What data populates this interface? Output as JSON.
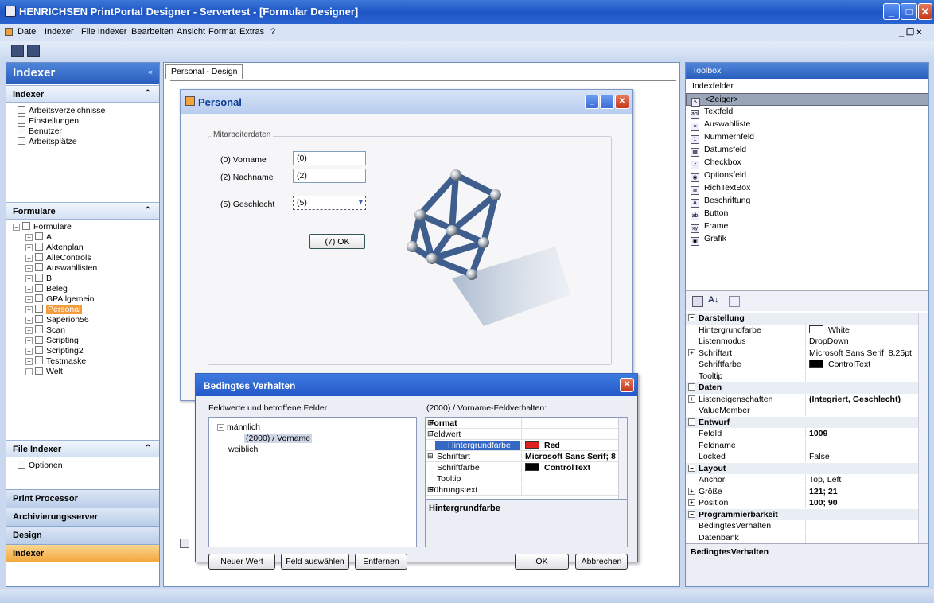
{
  "window": {
    "title": "HENRICHSEN PrintPortal Designer - Servertest - [Formular Designer]"
  },
  "menu": [
    "Datei",
    "Indexer",
    "File Indexer",
    "Bearbeiten",
    "Ansicht",
    "Format",
    "Extras",
    "?"
  ],
  "left": {
    "header": "Indexer",
    "indexer_section": "Indexer",
    "indexer_items": [
      "Arbeitsverzeichnisse",
      "Einstellungen",
      "Benutzer",
      "Arbeitsplätze"
    ],
    "formulare_section": "Formulare",
    "formulare_root": "Formulare",
    "formulare_items": [
      "A",
      "Aktenplan",
      "AlleControls",
      "Auswahllisten",
      "B",
      "Beleg",
      "GPAllgemein",
      "Personal",
      "Saperion56",
      "Scan",
      "Scripting",
      "Scripting2",
      "Testmaske",
      "Welt"
    ],
    "file_indexer_section": "File Indexer",
    "file_indexer_items": [
      "Optionen"
    ],
    "bottom_buttons": [
      "Print Processor",
      "Archivierungsserver",
      "Design",
      "Indexer"
    ]
  },
  "center": {
    "tab": "Personal - Design",
    "form": {
      "title": "Personal",
      "group": "Mitarbeiterdaten",
      "vorname_label": "(0) Vorname",
      "vorname_value": "(0)",
      "nachname_label": "(2) Nachname",
      "nachname_value": "(2)",
      "geschlecht_label": "(5) Geschlecht",
      "geschlecht_value": "(5)",
      "ok_label": "(7) OK"
    }
  },
  "dialog": {
    "title": "Bedingtes Verhalten",
    "left_label": "Feldwerte und betroffene Felder",
    "right_label": "(2000) / Vorname-Feldverhalten:",
    "tree": [
      "männlich",
      "(2000) / Vorname",
      "weiblich"
    ],
    "grid": [
      {
        "name": "Format",
        "value": "",
        "cat": true
      },
      {
        "name": "Feldwert",
        "value": "",
        "cat": false
      },
      {
        "name": "Hintergrundfarbe",
        "value": "Red",
        "sel": true
      },
      {
        "name": "Schriftart",
        "value": "Microsoft Sans Serif; 8"
      },
      {
        "name": "Schriftfarbe",
        "value": "ControlText"
      },
      {
        "name": "Tooltip",
        "value": ""
      },
      {
        "name": "Führungstext",
        "value": ""
      }
    ],
    "desc": "Hintergrundfarbe",
    "buttons": {
      "new": "Neuer Wert",
      "select": "Feld auswählen",
      "remove": "Entfernen",
      "ok": "OK",
      "cancel": "Abbrechen"
    }
  },
  "right": {
    "header": "Toolbox",
    "sub": "Indexfelder",
    "tools": [
      {
        "label": "<Zeiger>",
        "glyph": "↖"
      },
      {
        "label": "Textfeld",
        "glyph": "abl"
      },
      {
        "label": "Auswahlliste",
        "glyph": "≡"
      },
      {
        "label": "Nummernfeld",
        "glyph": "1"
      },
      {
        "label": "Datumsfeld",
        "glyph": "▦"
      },
      {
        "label": "Checkbox",
        "glyph": "✓"
      },
      {
        "label": "Optionsfeld",
        "glyph": "◉"
      },
      {
        "label": "RichTextBox",
        "glyph": "≣"
      },
      {
        "label": "Beschriftung",
        "glyph": "A"
      },
      {
        "label": "Button",
        "glyph": "ab"
      },
      {
        "label": "Frame",
        "glyph": "xy"
      },
      {
        "label": "Grafik",
        "glyph": "▣"
      }
    ],
    "props": [
      {
        "n": "Darstellung",
        "v": "",
        "cat": true
      },
      {
        "n": "Hintergrundfarbe",
        "v": "White",
        "sw": "#ffffff"
      },
      {
        "n": "Listenmodus",
        "v": "DropDown"
      },
      {
        "n": "Schriftart",
        "v": "Microsoft Sans Serif; 8,25pt",
        "exp": true
      },
      {
        "n": "Schriftfarbe",
        "v": "ControlText",
        "sw": "#000000"
      },
      {
        "n": "Tooltip",
        "v": ""
      },
      {
        "n": "Daten",
        "v": "",
        "cat": true
      },
      {
        "n": "Listeneigenschaften",
        "v": "(Integriert, Geschlecht)",
        "exp": true,
        "b": true
      },
      {
        "n": "ValueMember",
        "v": ""
      },
      {
        "n": "Entwurf",
        "v": "",
        "cat": true
      },
      {
        "n": "FeldId",
        "v": "1009",
        "b": true
      },
      {
        "n": "Feldname",
        "v": ""
      },
      {
        "n": "Locked",
        "v": "False"
      },
      {
        "n": "Layout",
        "v": "",
        "cat": true
      },
      {
        "n": "Anchor",
        "v": "Top, Left"
      },
      {
        "n": "Größe",
        "v": "121; 21",
        "exp": true,
        "b": true
      },
      {
        "n": "Position",
        "v": "100; 90",
        "exp": true,
        "b": true
      },
      {
        "n": "Programmierbarkeit",
        "v": "",
        "cat": true
      },
      {
        "n": "BedingtesVerhalten",
        "v": ""
      },
      {
        "n": "Datenbank",
        "v": ""
      }
    ],
    "desc": "BedingtesVerhalten"
  }
}
